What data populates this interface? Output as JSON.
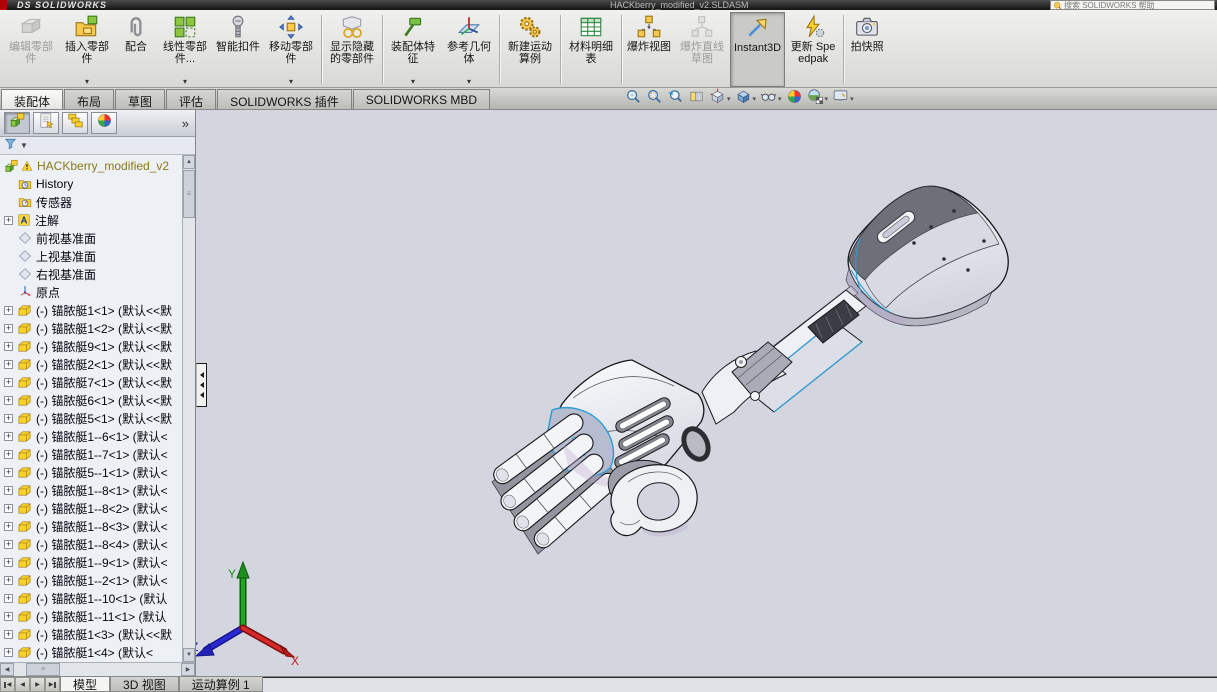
{
  "titlebar": {
    "logo": "DS SOLIDWORKS",
    "document_title": "HACKberry_modified_v2.SLDASM",
    "search_placeholder": "搜索 SOLIDWORKS 帮助"
  },
  "ribbon": {
    "buttons": [
      {
        "label": "编辑零部件",
        "icon": "edit-component",
        "disabled": true
      },
      {
        "label": "插入零部件",
        "icon": "insert-component",
        "caret": true
      },
      {
        "label": "配合",
        "icon": "mate"
      },
      {
        "label": "线性零部件...",
        "icon": "linear-pattern",
        "caret": true
      },
      {
        "label": "智能扣件",
        "icon": "smart-fasteners"
      },
      {
        "label": "移动零部件",
        "icon": "move-component",
        "caret": true,
        "sep_after": true
      },
      {
        "label": "显示隐藏的零部件",
        "icon": "show-hidden",
        "sep_after": true
      },
      {
        "label": "装配体特征",
        "icon": "assembly-features",
        "caret": true
      },
      {
        "label": "参考几何体",
        "icon": "reference-geometry",
        "caret": true,
        "sep_after": true
      },
      {
        "label": "新建运动算例",
        "icon": "motion-study",
        "sep_after": true
      },
      {
        "label": "材料明细表",
        "icon": "bom",
        "sep_after": true
      },
      {
        "label": "爆炸视图",
        "icon": "exploded-view"
      },
      {
        "label": "爆炸直线草图",
        "icon": "explode-sketch",
        "disabled": true
      },
      {
        "label": "Instant3D",
        "icon": "instant3d",
        "active": true
      },
      {
        "label": "更新 Speedpak",
        "icon": "update-speedpak",
        "sep_after": true
      },
      {
        "label": "拍快照",
        "icon": "snapshot"
      }
    ]
  },
  "command_tabs": {
    "items": [
      "装配体",
      "布局",
      "草图",
      "评估",
      "SOLIDWORKS 插件",
      "SOLIDWORKS MBD"
    ],
    "active": "装配体"
  },
  "view_toolbar": {
    "icons": [
      {
        "name": "zoom-fit-icon"
      },
      {
        "name": "zoom-area-icon"
      },
      {
        "name": "previous-view-icon"
      },
      {
        "name": "section-view-icon"
      },
      {
        "name": "view-orientation-icon",
        "caret": true
      },
      {
        "name": "display-style-icon",
        "caret": true
      },
      {
        "name": "hide-show-items-icon",
        "caret": true
      },
      {
        "name": "edit-appearance-icon"
      },
      {
        "name": "apply-scene-icon",
        "caret": true
      },
      {
        "name": "view-settings-icon",
        "caret": true
      }
    ]
  },
  "left_panel": {
    "tab_icons": [
      "featuremanager-tree-icon",
      "propertymanager-icon",
      "configurationmanager-icon",
      "displaymanager-icon"
    ],
    "chevron": "»",
    "filter_icon": "filter-funnel-icon"
  },
  "feature_tree": {
    "root": {
      "label": "HACKberry_modified_v2",
      "icon": "assembly",
      "warning": true
    },
    "items": [
      {
        "label": "History",
        "icon": "history"
      },
      {
        "label": "传感器",
        "icon": "sensors"
      },
      {
        "label": "注解",
        "icon": "annotations",
        "expander": true
      },
      {
        "label": "前视基准面",
        "icon": "plane"
      },
      {
        "label": "上视基准面",
        "icon": "plane"
      },
      {
        "label": "右视基准面",
        "icon": "plane"
      },
      {
        "label": "原点",
        "icon": "origin"
      }
    ],
    "components": [
      "(-) 锚脓艇1<1> (默认<<默",
      "(-) 锚脓艇1<2> (默认<<默",
      "(-) 锚脓艇9<1> (默认<<默",
      "(-) 锚脓艇2<1> (默认<<默",
      "(-) 锚脓艇7<1> (默认<<默",
      "(-) 锚脓艇6<1> (默认<<默",
      "(-) 锚脓艇5<1> (默认<<默",
      "(-) 锚脓艇1--6<1> (默认<",
      "(-) 锚脓艇1--7<1> (默认<",
      "(-) 锚脓艇5--1<1> (默认<",
      "(-) 锚脓艇1--8<1> (默认<",
      "(-) 锚脓艇1--8<2> (默认<",
      "(-) 锚脓艇1--8<3> (默认<",
      "(-) 锚脓艇1--8<4> (默认<",
      "(-) 锚脓艇1--9<1> (默认<",
      "(-) 锚脓艇1--2<1> (默认<",
      "(-) 锚脓艇1--10<1> (默认",
      "(-) 锚脓艇1--11<1> (默认",
      "(-) 锚脓艇1<3> (默认<<默",
      "(-) 锚脓艇1<4> (默认<"
    ]
  },
  "status_bar": {
    "tabs": [
      "模型",
      "3D 视图",
      "运动算例 1"
    ],
    "active": "模型"
  },
  "triad": {
    "x_label": "X",
    "y_label": "Y",
    "z_label": "Z"
  },
  "colors": {
    "viewport_bg": "#d3d6de",
    "accent_cyan": "#2e9bd6",
    "titlebar_red": "#b40000",
    "part_yellow": "#f8d12a",
    "pattern_green": "#8dc63f"
  }
}
